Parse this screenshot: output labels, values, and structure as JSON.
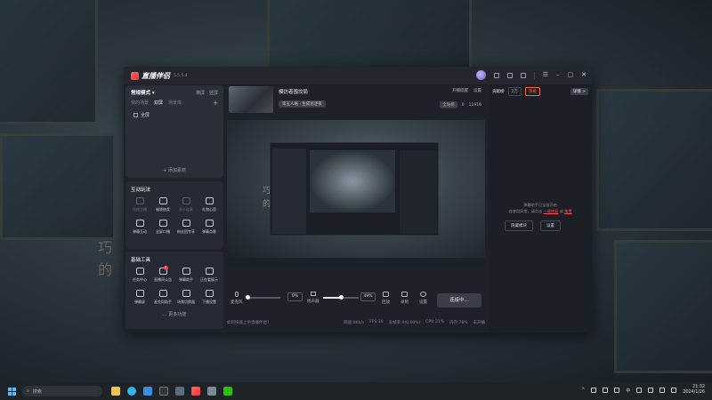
{
  "app": {
    "name": "直播伴侣",
    "version": "5.5.5.4",
    "accent": "#ff4d4f"
  },
  "left": {
    "mode": "常规模式 ▾",
    "mode_links": [
      "横屏",
      "竖屏"
    ],
    "scene_tabs": [
      "我的场景",
      "双屏",
      "场景库"
    ],
    "scene_item": "全屏",
    "add_source": "+ 添加素材",
    "interactive_title": "互动玩法",
    "interactive": [
      {
        "label": "连线主播",
        "dim": true
      },
      {
        "label": "福袋抽奖",
        "dim": false
      },
      {
        "label": "多人连麦",
        "dim": true
      },
      {
        "label": "礼物心愿",
        "dim": false
      },
      {
        "label": "弹幕互动",
        "dim": false
      },
      {
        "label": "全屏口播",
        "dim": false
      },
      {
        "label": "粉丝团专享",
        "dim": false
      },
      {
        "label": "弹幕点歌",
        "dim": false
      }
    ],
    "basic_title": "基础工具",
    "basic": [
      {
        "label": "任务中心",
        "badge": ""
      },
      {
        "label": "直播间公告",
        "badge": "1"
      },
      {
        "label": "弹幕助手",
        "badge": ""
      },
      {
        "label": "正在看展示",
        "badge": ""
      },
      {
        "label": "弹幕屏",
        "badge": ""
      },
      {
        "label": "麦克风助手",
        "badge": ""
      },
      {
        "label": "场景切换器",
        "badge": ""
      },
      {
        "label": "下播设置",
        "badge": ""
      }
    ],
    "more": "… 更多功能"
  },
  "room": {
    "title": "模仿者围坟局",
    "tag": "第五人格 · 生成巡逻夜",
    "top_actions": [
      "开播提醒",
      "设置"
    ],
    "bottom": [
      "全站榜",
      "0",
      "11916"
    ]
  },
  "preview_texts": [
    "巧",
    "的"
  ],
  "controls": {
    "mic_label": "麦克风",
    "mic_value": "0%",
    "speaker_label": "扬声器",
    "speaker_value": "49%",
    "rec_label": "录制",
    "replay_label": "回放",
    "settings_label": "设置",
    "go_live": "连接中..."
  },
  "status": {
    "tip": "如何快速上手直播伴侣?",
    "stats": [
      "网速:0Kb/s",
      "FPS:30",
      "丢帧率:0(0.00%)",
      "CPU:21%",
      "内存:76%",
      "未开播"
    ]
  },
  "right": {
    "tab": "贡献榜",
    "count": "2万",
    "hot": "热榜",
    "btn": "详情 >",
    "msg_line1": "弹幕助手已全部开启",
    "msg_line2a": "若使用异常，请点击",
    "msg_link1": "一键修复",
    "msg_line2b": "或",
    "msg_link2": "重置",
    "actions": [
      "隐藏模块",
      "设置"
    ]
  },
  "taskbar": {
    "search_placeholder": "搜索",
    "lang": "中",
    "time": "21:32",
    "date": "2024/1/26"
  }
}
